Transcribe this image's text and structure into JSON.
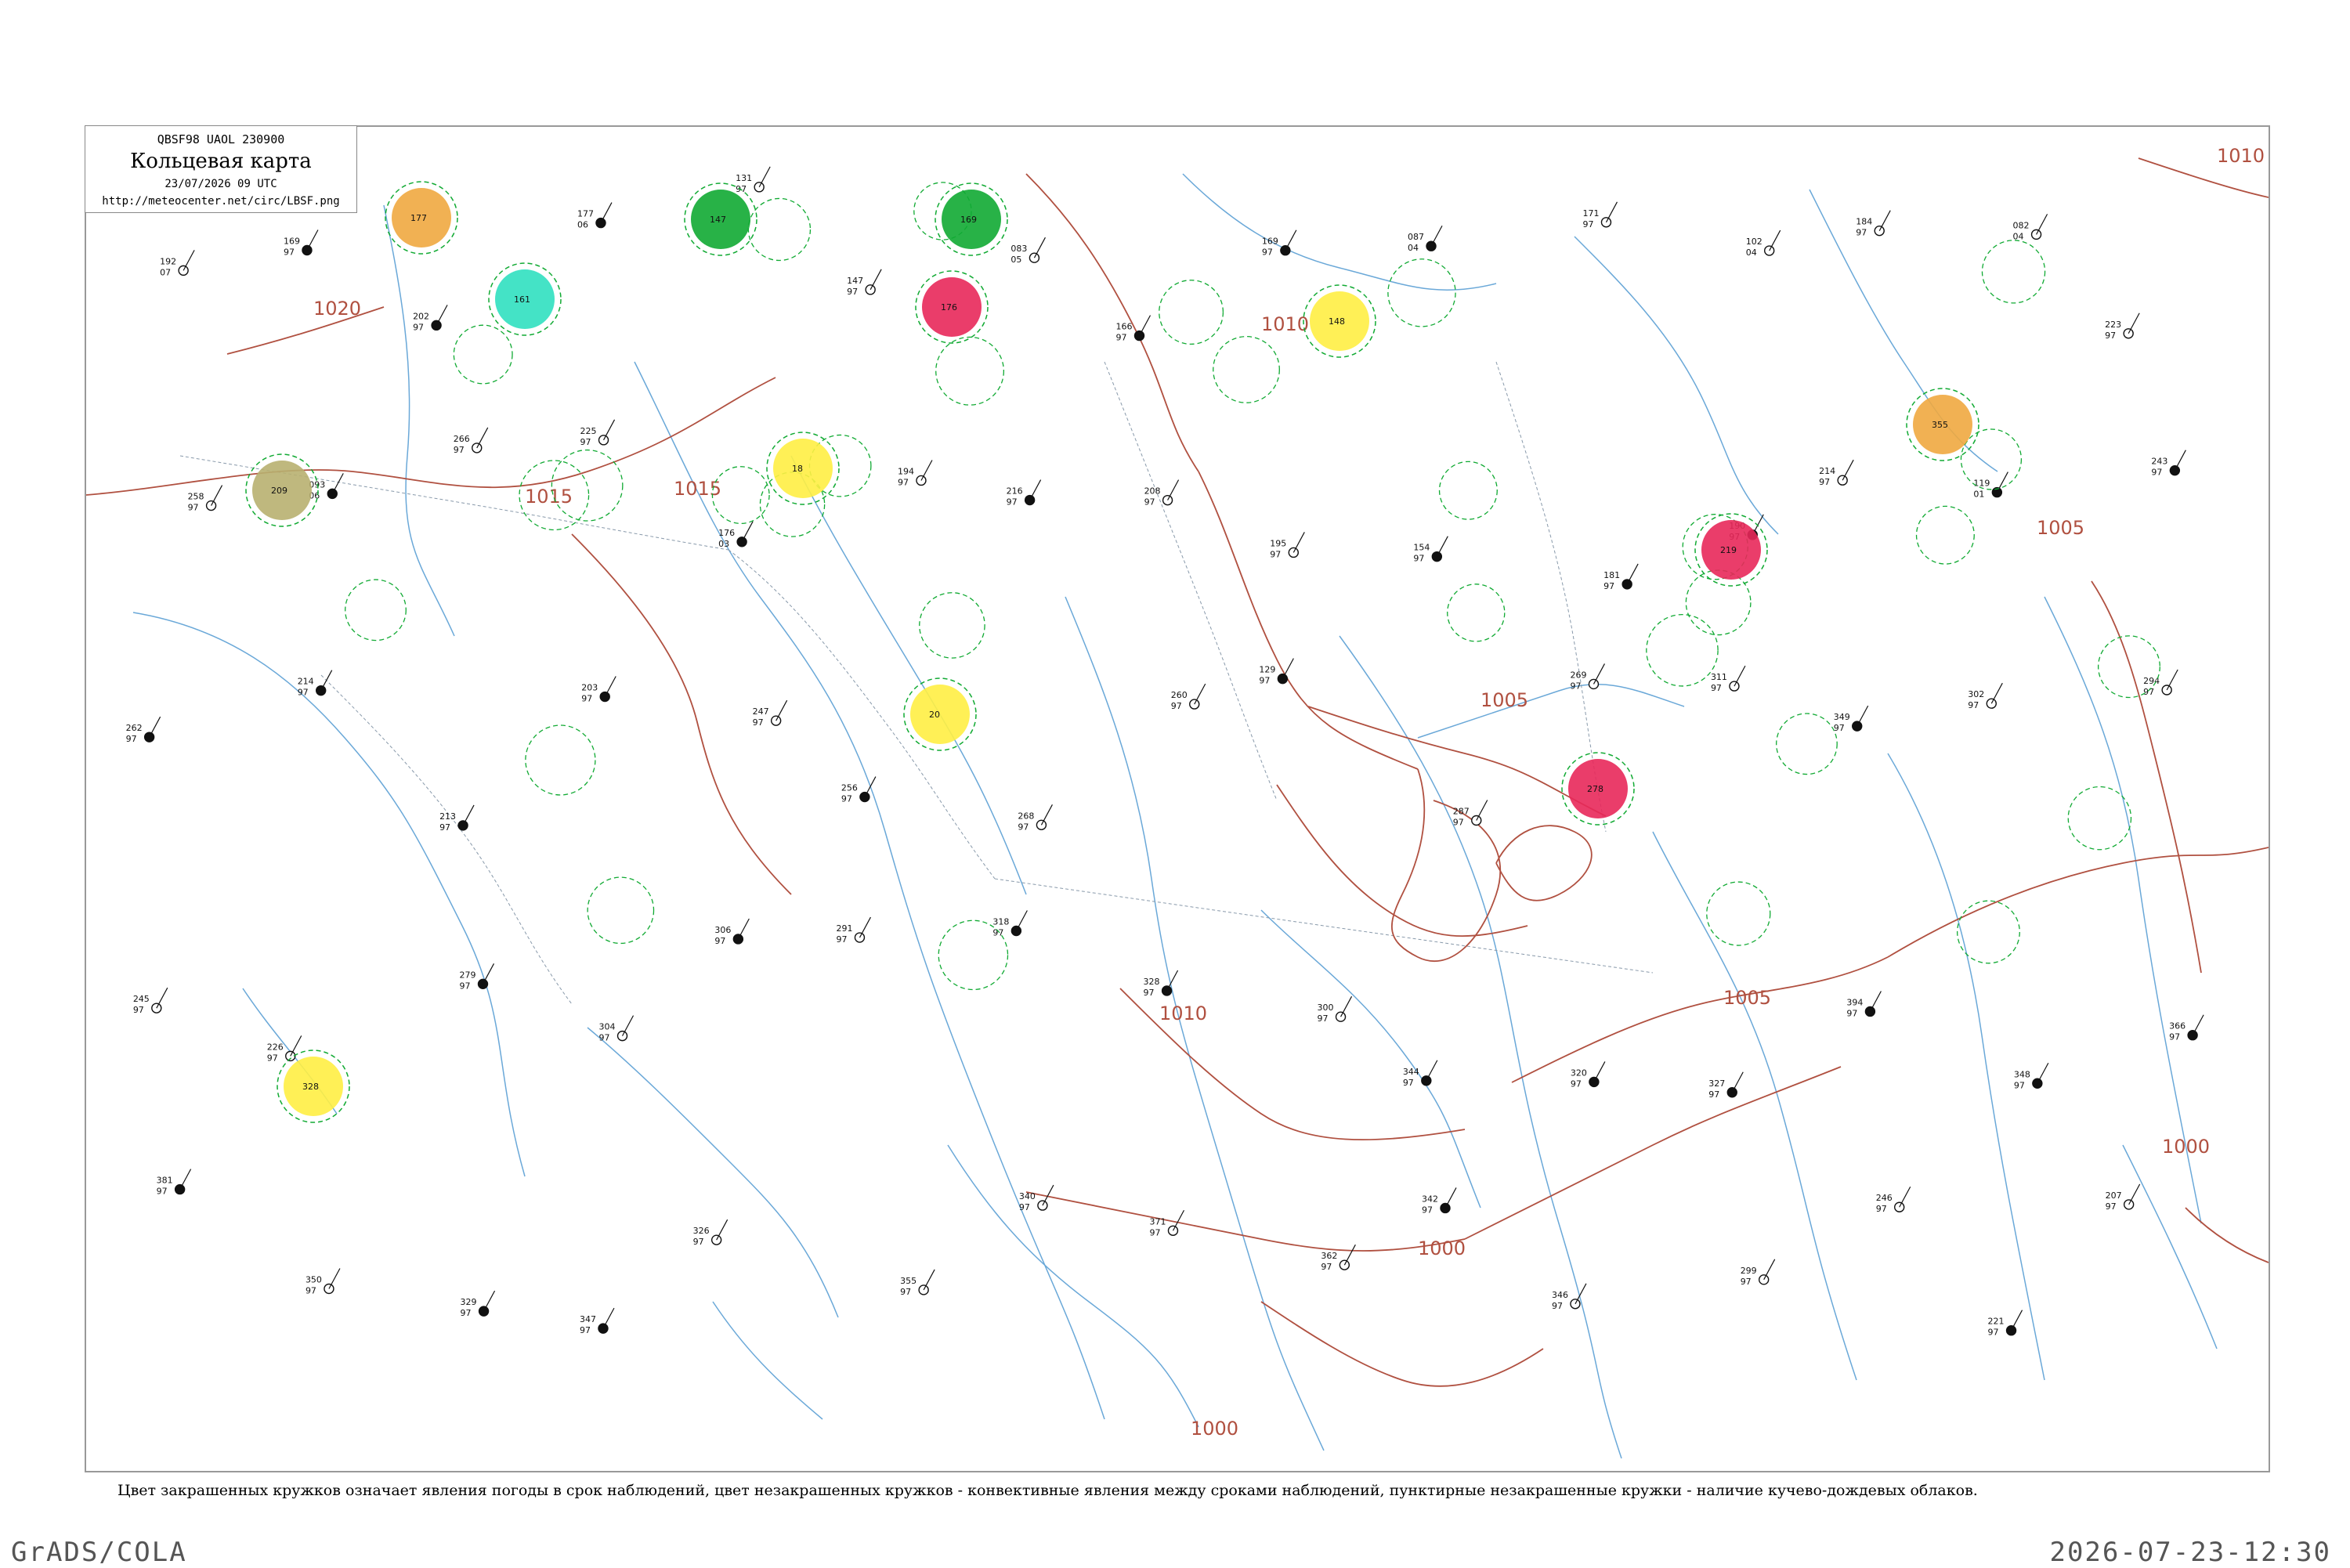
{
  "header": {
    "code": "QBSF98  UAOL  230900",
    "title": "Кольцевая карта",
    "date": "23/07/2026 09 UTC",
    "url": "http://meteocenter.net/circ/LBSF.png"
  },
  "caption": "Цвет закрашенных кружков означает явления погоды в срок наблюдений, цвет незакрашенных кружков - конвективные явления между сроками наблюдений, пунктирные незакрашенные кружки - наличие кучево-дождевых облаков.",
  "footer": {
    "left": "GrADS/COLA",
    "right": "2026-07-23-12:30"
  },
  "colors": {
    "isobar": "#b05040",
    "water": "#6aa8d8",
    "border": "#8899aa",
    "rain": "#11aa33",
    "thunder": "#e8285a",
    "snow_like": "#30e0c0",
    "fog": "#ffee44",
    "haze": "#f0a840",
    "dust": "#b8b070",
    "cb_dashed": "#11aa33"
  },
  "isobars": [
    {
      "label": "1010"
    },
    {
      "label": "1015"
    },
    {
      "label": "1020"
    },
    {
      "label": "1015"
    },
    {
      "label": "1010"
    },
    {
      "label": "1005"
    },
    {
      "label": "1005"
    },
    {
      "label": "1010"
    },
    {
      "label": "1005"
    },
    {
      "label": "1000"
    },
    {
      "label": "1000"
    },
    {
      "label": "1000"
    }
  ],
  "stations": [
    {
      "num": "192",
      "id": "07"
    },
    {
      "num": "169",
      "id": "97"
    },
    {
      "num": "202",
      "id": "97"
    },
    {
      "num": "177",
      "id": "06"
    },
    {
      "num": "131",
      "id": "97"
    },
    {
      "num": "147",
      "id": "97"
    },
    {
      "num": "083",
      "id": "05"
    },
    {
      "num": "166",
      "id": "97"
    },
    {
      "num": "169",
      "id": "97"
    },
    {
      "num": "087",
      "id": "04"
    },
    {
      "num": "171",
      "id": "97"
    },
    {
      "num": "102",
      "id": "04"
    },
    {
      "num": "184",
      "id": "97"
    },
    {
      "num": "082",
      "id": "04"
    },
    {
      "num": "223",
      "id": "97"
    },
    {
      "num": "258",
      "id": "97"
    },
    {
      "num": "093",
      "id": "06"
    },
    {
      "num": "266",
      "id": "97"
    },
    {
      "num": "225",
      "id": "97"
    },
    {
      "num": "176",
      "id": "03"
    },
    {
      "num": "194",
      "id": "97"
    },
    {
      "num": "216",
      "id": "97"
    },
    {
      "num": "208",
      "id": "97"
    },
    {
      "num": "195",
      "id": "97"
    },
    {
      "num": "154",
      "id": "97"
    },
    {
      "num": "181",
      "id": "97"
    },
    {
      "num": "190",
      "id": "97"
    },
    {
      "num": "214",
      "id": "97"
    },
    {
      "num": "119",
      "id": "01"
    },
    {
      "num": "243",
      "id": "97"
    },
    {
      "num": "262",
      "id": "97"
    },
    {
      "num": "214",
      "id": "97"
    },
    {
      "num": "213",
      "id": "97"
    },
    {
      "num": "203",
      "id": "97"
    },
    {
      "num": "247",
      "id": "97"
    },
    {
      "num": "256",
      "id": "97"
    },
    {
      "num": "268",
      "id": "97"
    },
    {
      "num": "260",
      "id": "97"
    },
    {
      "num": "129",
      "id": "97"
    },
    {
      "num": "287",
      "id": "97"
    },
    {
      "num": "269",
      "id": "97"
    },
    {
      "num": "311",
      "id": "97"
    },
    {
      "num": "349",
      "id": "97"
    },
    {
      "num": "302",
      "id": "97"
    },
    {
      "num": "294",
      "id": "97"
    },
    {
      "num": "245",
      "id": "97"
    },
    {
      "num": "226",
      "id": "97"
    },
    {
      "num": "279",
      "id": "97"
    },
    {
      "num": "304",
      "id": "97"
    },
    {
      "num": "306",
      "id": "97"
    },
    {
      "num": "291",
      "id": "97"
    },
    {
      "num": "318",
      "id": "97"
    },
    {
      "num": "328",
      "id": "97"
    },
    {
      "num": "300",
      "id": "97"
    },
    {
      "num": "344",
      "id": "97"
    },
    {
      "num": "320",
      "id": "97"
    },
    {
      "num": "327",
      "id": "97"
    },
    {
      "num": "394",
      "id": "97"
    },
    {
      "num": "348",
      "id": "97"
    },
    {
      "num": "366",
      "id": "97"
    },
    {
      "num": "381",
      "id": "97"
    },
    {
      "num": "350",
      "id": "97"
    },
    {
      "num": "329",
      "id": "97"
    },
    {
      "num": "347",
      "id": "97"
    },
    {
      "num": "326",
      "id": "97"
    },
    {
      "num": "355",
      "id": "97"
    },
    {
      "num": "340",
      "id": "97"
    },
    {
      "num": "371",
      "id": "97"
    },
    {
      "num": "362",
      "id": "97"
    },
    {
      "num": "342",
      "id": "97"
    },
    {
      "num": "346",
      "id": "97"
    },
    {
      "num": "299",
      "id": "97"
    },
    {
      "num": "246",
      "id": "97"
    },
    {
      "num": "221",
      "id": "97"
    },
    {
      "num": "207",
      "id": "97"
    }
  ],
  "highlighted": [
    {
      "kind": "rain",
      "num": "147"
    },
    {
      "kind": "rain",
      "num": "169"
    },
    {
      "kind": "thunder",
      "num": "176"
    },
    {
      "kind": "fog",
      "num": "18"
    },
    {
      "kind": "snow_like",
      "num": "161"
    },
    {
      "kind": "haze",
      "num": "177"
    },
    {
      "kind": "dust",
      "num": "209"
    },
    {
      "kind": "fog",
      "num": "148"
    },
    {
      "kind": "thunder",
      "num": "219"
    },
    {
      "kind": "haze",
      "num": "355"
    },
    {
      "kind": "fog",
      "num": "20"
    },
    {
      "kind": "fog",
      "num": "328"
    },
    {
      "kind": "thunder",
      "num": "278"
    }
  ]
}
